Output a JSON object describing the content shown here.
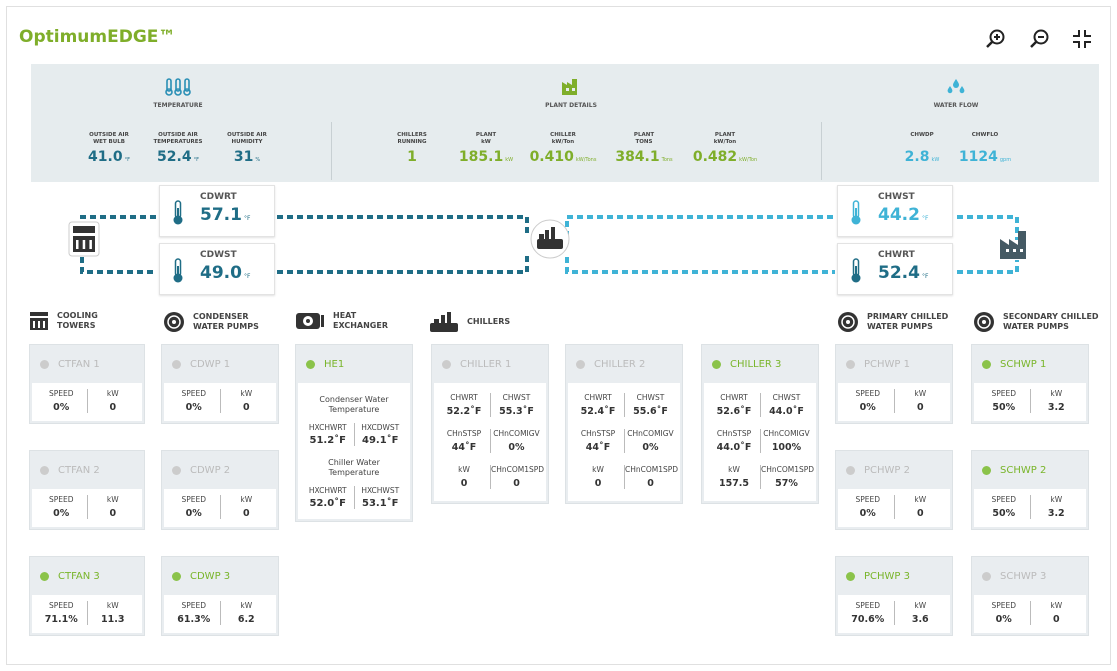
{
  "app": {
    "title": "OptimumEDGE™"
  },
  "toolbar": {
    "zoom_in_icon": "zoom-in-icon",
    "zoom_out_icon": "zoom-out-icon",
    "compress_icon": "compress-icon"
  },
  "stats": {
    "temperature": {
      "title": "TEMPERATURE",
      "items": [
        {
          "label1": "OUTSIDE AIR",
          "label2": "WET BULB",
          "value": "41.0",
          "unit": "°F"
        },
        {
          "label1": "OUTSIDE AIR",
          "label2": "TEMPERATURES",
          "value": "52.4",
          "unit": "°F"
        },
        {
          "label1": "OUTSIDE AIR",
          "label2": "HUMIDITY",
          "value": "31",
          "unit": "%"
        }
      ]
    },
    "plant": {
      "title": "PLANT DETAILS",
      "items": [
        {
          "label1": "CHILLERS",
          "label2": "RUNNING",
          "value": "1",
          "unit": ""
        },
        {
          "label1": "PLANT",
          "label2": "kW",
          "value": "185.1",
          "unit": "kW"
        },
        {
          "label1": "CHILLER",
          "label2": "kW/Ton",
          "value": "0.410",
          "unit": "kW/Tons"
        },
        {
          "label1": "PLANT",
          "label2": "TONS",
          "value": "384.1",
          "unit": "Tons"
        },
        {
          "label1": "PLANT",
          "label2": "kW/Ton",
          "value": "0.482",
          "unit": "kW/Ton"
        }
      ]
    },
    "water": {
      "title": "WATER FLOW",
      "items": [
        {
          "label1": "CHWDP",
          "label2": "",
          "value": "2.8",
          "unit": "kW"
        },
        {
          "label1": "CHWFLO",
          "label2": "",
          "value": "1124",
          "unit": "gpm"
        }
      ]
    }
  },
  "flow": {
    "cdwrt": {
      "label": "CDWRT",
      "value": "57.1",
      "unit": "°F"
    },
    "cdwst": {
      "label": "CDWST",
      "value": "49.0",
      "unit": "°F"
    },
    "chwst": {
      "label": "CHWST",
      "value": "44.2",
      "unit": "°F"
    },
    "chwrt": {
      "label": "CHWRT",
      "value": "52.4",
      "unit": "°F"
    }
  },
  "sections": {
    "cooling_towers": [
      "COOLING",
      "TOWERS"
    ],
    "condenser_pumps": [
      "CONDENSER",
      "WATER PUMPS"
    ],
    "heat_exchanger": [
      "HEAT",
      "EXCHANGER"
    ],
    "chillers": [
      "CHILLERS"
    ],
    "primary_pumps": [
      "PRIMARY CHILLED",
      "WATER PUMPS"
    ],
    "secondary_pumps": [
      "SECONDARY CHILLED",
      "WATER PUMPS"
    ]
  },
  "cols": {
    "speed": "SPEED",
    "kw": "kW"
  },
  "towers": [
    {
      "name": "CTFAN 1",
      "speed": "0%",
      "kw": "0"
    },
    {
      "name": "CTFAN 2",
      "speed": "0%",
      "kw": "0"
    },
    {
      "name": "CTFAN 3",
      "speed": "71.1%",
      "kw": "11.3"
    }
  ],
  "cdwp": [
    {
      "name": "CDWP 1",
      "speed": "0%",
      "kw": "0"
    },
    {
      "name": "CDWP 2",
      "speed": "0%",
      "kw": "0"
    },
    {
      "name": "CDWP 3",
      "speed": "61.3%",
      "kw": "6.2"
    }
  ],
  "he": {
    "name": "HE1",
    "cond_label": "Condenser Water Temperature",
    "hxchwrt_label": "HXCHWRT",
    "hxchwrt": "51.2˚F",
    "hxcdwst_label": "HXCDWST",
    "hxcdwst": "49.1˚F",
    "chill_label": "Chiller Water Temperature",
    "hxchwrt2_label": "HXCHWRT",
    "hxchwrt2": "52.0˚F",
    "hxchwst_label": "HXCHWST",
    "hxchwst": "53.1˚F"
  },
  "chiller_labels": {
    "chwrt": "CHWRT",
    "chwst": "CHWST",
    "stsp": "CHnSTSP",
    "igv": "CHnCOMIGV",
    "kw": "kW",
    "spd": "CHnCOM1SPD"
  },
  "chillers": [
    {
      "name": "CHILLER 1",
      "chwrt": "52.2˚F",
      "chwst": "55.3˚F",
      "stsp": "44˚F",
      "igv": "0%",
      "kw": "0",
      "spd": "0"
    },
    {
      "name": "CHILLER 2",
      "chwrt": "52.4˚F",
      "chwst": "55.6˚F",
      "stsp": "44˚F",
      "igv": "0%",
      "kw": "0",
      "spd": "0"
    },
    {
      "name": "CHILLER 3",
      "chwrt": "52.6˚F",
      "chwst": "44.0˚F",
      "stsp": "44.0˚F",
      "igv": "100%",
      "kw": "157.5",
      "spd": "57%"
    }
  ],
  "pchwp": [
    {
      "name": "PCHWP 1",
      "speed": "0%",
      "kw": "0"
    },
    {
      "name": "PCHWP 2",
      "speed": "0%",
      "kw": "0"
    },
    {
      "name": "PCHWP 3",
      "speed": "70.6%",
      "kw": "3.6"
    }
  ],
  "schwp": [
    {
      "name": "SCHWP 1",
      "speed": "50%",
      "kw": "3.2"
    },
    {
      "name": "SCHWP 2",
      "speed": "50%",
      "kw": "3.2"
    },
    {
      "name": "SCHWP 3",
      "speed": "0%",
      "kw": "0"
    }
  ],
  "colors": {
    "green": "#7fae2a",
    "teal": "#1f6d86",
    "lightblue": "#3fb3d6",
    "on_dot": "#8bc34a",
    "off_dot": "#cccccc"
  }
}
